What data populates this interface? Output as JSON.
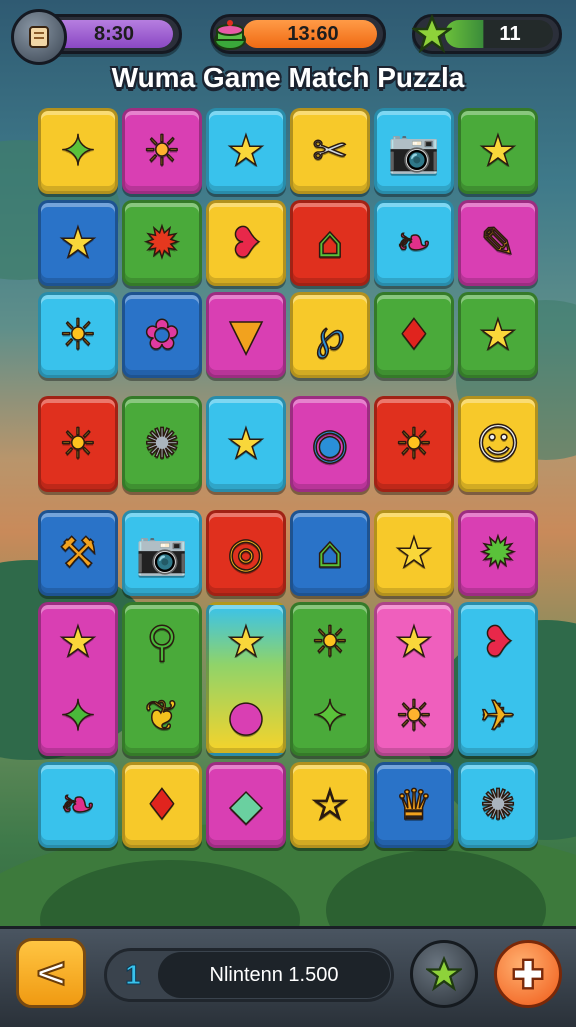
{
  "hud": {
    "time": {
      "value": "8:30",
      "icon": "scroll-icon"
    },
    "score": {
      "value": "13:60",
      "icon": "cake-icon"
    },
    "stars": {
      "value": "11",
      "icon": "star-icon"
    }
  },
  "title": "Wuma Game Match Puzzla",
  "board": {
    "rows": [
      [
        {
          "color": "yellow",
          "icons": [
            "✦"
          ],
          "names": [
            "green-star-icon"
          ]
        },
        {
          "color": "magenta",
          "icons": [
            "☀"
          ],
          "names": [
            "sun-face-icon"
          ]
        },
        {
          "color": "cyan",
          "icons": [
            "★"
          ],
          "names": [
            "star-icon"
          ]
        },
        {
          "color": "yellow",
          "icons": [
            "✂"
          ],
          "names": [
            "tools-icon"
          ]
        },
        {
          "color": "cyan",
          "icons": [
            "📷"
          ],
          "names": [
            "camera-icon"
          ]
        },
        {
          "color": "green",
          "icons": [
            "★"
          ],
          "names": [
            "star-icon"
          ]
        }
      ],
      [
        {
          "color": "blue",
          "icons": [
            "★"
          ],
          "names": [
            "star-icon"
          ]
        },
        {
          "color": "green",
          "icons": [
            "✹"
          ],
          "names": [
            "red-sun-icon"
          ]
        },
        {
          "color": "yellow",
          "icons": [
            "❥"
          ],
          "names": [
            "speech-bubble-icon"
          ]
        },
        {
          "color": "red",
          "icons": [
            "⌂"
          ],
          "names": [
            "house-icon"
          ]
        },
        {
          "color": "cyan",
          "icons": [
            "❧"
          ],
          "names": [
            "bean-icon"
          ]
        },
        {
          "color": "magenta",
          "icons": [
            "✎"
          ],
          "names": [
            "microphone-icon"
          ]
        }
      ],
      [
        {
          "color": "cyan",
          "icons": [
            "☀"
          ],
          "names": [
            "sun-icon"
          ]
        },
        {
          "color": "blue",
          "icons": [
            "✿"
          ],
          "names": [
            "flower-icon"
          ]
        },
        {
          "color": "magenta",
          "icons": [
            "▼"
          ],
          "names": [
            "ice-cream-icon"
          ]
        },
        {
          "color": "yellow",
          "icons": [
            "℘"
          ],
          "names": [
            "swirl-icon"
          ]
        },
        {
          "color": "green",
          "icons": [
            "♦"
          ],
          "names": [
            "red-gem-icon"
          ]
        },
        {
          "color": "green",
          "icons": [
            "★"
          ],
          "names": [
            "star-icon"
          ]
        }
      ],
      [
        {
          "color": "red",
          "icons": [
            "☀"
          ],
          "names": [
            "sun-icon"
          ]
        },
        {
          "color": "green",
          "icons": [
            "✺"
          ],
          "names": [
            "robot-icon"
          ]
        },
        {
          "color": "cyan",
          "icons": [
            "★"
          ],
          "names": [
            "star-icon"
          ]
        },
        {
          "color": "magenta",
          "icons": [
            "◉"
          ],
          "names": [
            "swirl-icon"
          ]
        },
        {
          "color": "red",
          "icons": [
            "☀"
          ],
          "names": [
            "sun-icon"
          ]
        },
        {
          "color": "yellow",
          "icons": [
            "☺"
          ],
          "names": [
            "helmet-face-icon"
          ]
        }
      ],
      [
        {
          "color": "blue",
          "icons": [
            "⚒"
          ],
          "names": [
            "hammer-icon"
          ]
        },
        {
          "color": "cyan",
          "icons": [
            "📷"
          ],
          "names": [
            "camera-icon"
          ]
        },
        {
          "color": "red",
          "icons": [
            "◎"
          ],
          "names": [
            "ring-icon"
          ]
        },
        {
          "color": "blue",
          "icons": [
            "⌂"
          ],
          "names": [
            "house-icon"
          ]
        },
        {
          "color": "yellow",
          "icons": [
            "★"
          ],
          "names": [
            "star-icon"
          ]
        },
        {
          "color": "magenta",
          "icons": [
            "✹"
          ],
          "names": [
            "gear-icon"
          ]
        }
      ],
      [
        {
          "color": "magenta",
          "icons": [
            "★",
            "✦"
          ],
          "names": [
            "star-icon",
            "green-creature-icon"
          ]
        },
        {
          "color": "green",
          "icons": [
            "⚲",
            "❦"
          ],
          "names": [
            "magnifier-icon",
            "bird-icon"
          ]
        },
        {
          "color": "rainbow",
          "icons": [
            "★",
            "●"
          ],
          "names": [
            "star-icon",
            "ball-icon"
          ]
        },
        {
          "color": "green",
          "icons": [
            "☀",
            "✦"
          ],
          "names": [
            "sun-icon",
            "green-star-icon"
          ]
        },
        {
          "color": "pink",
          "icons": [
            "★",
            "☀"
          ],
          "names": [
            "star-icon",
            "sun-face-icon"
          ]
        },
        {
          "color": "cyan",
          "icons": [
            "❥",
            "✈"
          ],
          "names": [
            "speech-bubble-icon",
            "rocket-icon"
          ]
        }
      ],
      [
        {
          "color": "cyan",
          "icons": [
            "❧"
          ],
          "names": [
            "bean-icon"
          ]
        },
        {
          "color": "yellow",
          "icons": [
            "♦"
          ],
          "names": [
            "red-gem-icon"
          ]
        },
        {
          "color": "magenta",
          "icons": [
            "◆"
          ],
          "names": [
            "gem-icon"
          ]
        },
        {
          "color": "yellow",
          "icons": [
            "☆"
          ],
          "names": [
            "star-icon"
          ]
        },
        {
          "color": "blue",
          "icons": [
            "♛"
          ],
          "names": [
            "ice-cream-icon"
          ]
        },
        {
          "color": "cyan",
          "icons": [
            "✺"
          ],
          "names": [
            "robot-icon"
          ]
        }
      ]
    ]
  },
  "bottom": {
    "back_icon": "back-arrow-icon",
    "level_number": "1",
    "level_label": "Nlintenn 1.500",
    "star_button_icon": "star-icon",
    "add_button_icon": "plus-icon"
  },
  "colors": {
    "yellow": "#f7c92a",
    "magenta": "#d93fb3",
    "cyan": "#39c2ec",
    "green": "#4aaa3a",
    "blue": "#2a73c8",
    "red": "#e0301e",
    "pink": "#ef5fbd"
  }
}
